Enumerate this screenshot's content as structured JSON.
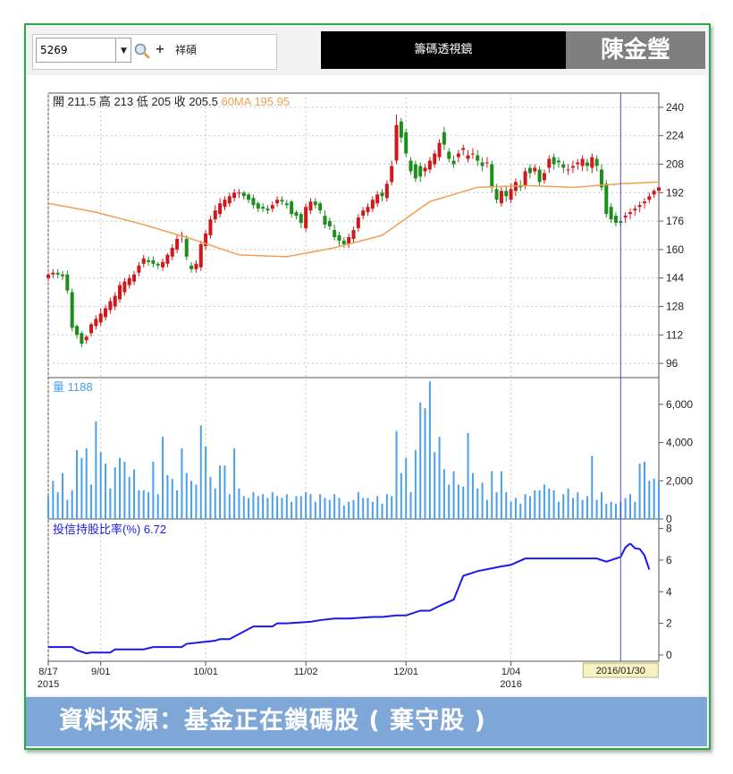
{
  "toolbar": {
    "stock_code": "5269",
    "dropdown_glyph": "▼",
    "zoom_icon": "magnifier-icon",
    "plus_label": "+",
    "detail_label": "祥碩",
    "title": "籌碼透視鏡",
    "author": "陳金瑩"
  },
  "footer": {
    "caption": "資料來源：基金正在鎖碼股 ( 棄守股 )"
  },
  "colors": {
    "up": "#d0181c",
    "down": "#1d8d1d",
    "ma": "#f0a050",
    "volume": "#4aa0e8",
    "holding": "#1a1ae6",
    "cursor": "#4a4ae0",
    "border": "#2aa84a",
    "footer": "#7ea6d6"
  },
  "chart_data": [
    {
      "type": "candlestick",
      "panel": "price",
      "legend": {
        "open_label": "開",
        "open": "211.5",
        "high_label": "高",
        "high": "213",
        "low_label": "低",
        "low": "205",
        "close_label": "收",
        "close": "205.5",
        "ma_label": "60MA",
        "ma": "195.95"
      },
      "ylim": [
        88,
        248
      ],
      "yticks": [
        96,
        112,
        128,
        144,
        160,
        176,
        192,
        208,
        224,
        240
      ],
      "series": [
        {
          "name": "60MA",
          "type": "line",
          "x": [
            0,
            10,
            20,
            30,
            40,
            50,
            60,
            70,
            80,
            90,
            100,
            110,
            120,
            128
          ],
          "values": [
            186,
            181,
            174,
            166,
            157,
            156,
            161,
            168,
            187,
            195,
            196,
            195,
            197,
            198
          ]
        },
        {
          "name": "K",
          "type": "candlestick",
          "x": [
            0,
            1,
            2,
            3,
            4,
            5,
            6,
            7,
            8,
            9,
            10,
            11,
            12,
            13,
            14,
            15,
            16,
            17,
            18,
            19,
            20,
            21,
            22,
            23,
            24,
            25,
            26,
            27,
            28,
            29,
            30,
            31,
            32,
            33,
            34,
            35,
            36,
            37,
            38,
            39,
            40,
            41,
            42,
            43,
            44,
            45,
            46,
            47,
            48,
            49,
            50,
            51,
            52,
            53,
            54,
            55,
            56,
            57,
            58,
            59,
            60,
            61,
            62,
            63,
            64,
            65,
            66,
            67,
            68,
            69,
            70,
            71,
            72,
            73,
            74,
            75,
            76,
            77,
            78,
            79,
            80,
            81,
            82,
            83,
            84,
            85,
            86,
            87,
            88,
            89,
            90,
            91,
            92,
            93,
            94,
            95,
            96,
            97,
            98,
            99,
            100,
            101,
            102,
            103,
            104,
            105,
            106,
            107,
            108,
            109,
            110,
            111,
            112,
            113,
            114,
            115,
            116,
            117,
            118,
            119,
            120,
            121,
            122,
            123,
            124,
            125,
            126,
            127,
            128
          ],
          "open": [
            144,
            146,
            147,
            146,
            146,
            136,
            117,
            113,
            109,
            113,
            117,
            119,
            122,
            126,
            128,
            132,
            136,
            140,
            142,
            147,
            152,
            154,
            154,
            152,
            150,
            152,
            156,
            160,
            168,
            166,
            151,
            149,
            150,
            162,
            168,
            177,
            180,
            184,
            186,
            189,
            192,
            192,
            191,
            189,
            186,
            184,
            183,
            183,
            186,
            188,
            186,
            187,
            181,
            180,
            172,
            182,
            187,
            186,
            179,
            176,
            171,
            168,
            165,
            163,
            166,
            172,
            179,
            181,
            183,
            186,
            192,
            189,
            198,
            210,
            232,
            226,
            210,
            208,
            207,
            204,
            205,
            208,
            212,
            226,
            215,
            210,
            212,
            216,
            211,
            214,
            213,
            209,
            209,
            208,
            194,
            186,
            193,
            188,
            193,
            196,
            196,
            206,
            204,
            205,
            199,
            206,
            212,
            210,
            208,
            205,
            206,
            208,
            207,
            209,
            206,
            211,
            205,
            197,
            184,
            179,
            176,
            178,
            180,
            182,
            184,
            186,
            188,
            191,
            193
          ],
          "close": [
            146,
            147,
            146,
            145,
            137,
            116,
            112,
            107,
            111,
            118,
            121,
            124,
            127,
            131,
            134,
            140,
            142,
            144,
            146,
            151,
            155,
            153,
            152,
            151,
            153,
            157,
            161,
            166,
            168,
            156,
            149,
            152,
            163,
            169,
            177,
            182,
            186,
            188,
            190,
            192,
            192,
            190,
            188,
            185,
            183,
            183,
            182,
            185,
            188,
            187,
            185,
            180,
            179,
            175,
            184,
            187,
            185,
            182,
            174,
            173,
            167,
            165,
            163,
            167,
            171,
            178,
            182,
            184,
            188,
            191,
            190,
            197,
            207,
            230,
            223,
            214,
            204,
            200,
            201,
            206,
            210,
            214,
            220,
            219,
            211,
            208,
            214,
            217,
            213,
            214,
            210,
            207,
            209,
            195,
            188,
            193,
            190,
            194,
            198,
            195,
            204,
            203,
            206,
            198,
            203,
            211,
            208,
            209,
            206,
            205,
            207,
            209,
            211,
            207,
            212,
            207,
            195,
            180,
            177,
            175,
            175,
            179,
            181,
            183,
            185,
            187,
            190,
            193,
            195
          ],
          "high": [
            147,
            149,
            149,
            148,
            148,
            138,
            118,
            114,
            112,
            119,
            123,
            127,
            129,
            133,
            136,
            142,
            144,
            146,
            148,
            153,
            157,
            156,
            156,
            153,
            155,
            158,
            163,
            168,
            170,
            168,
            153,
            154,
            165,
            171,
            179,
            185,
            189,
            190,
            192,
            194,
            194,
            193,
            192,
            191,
            187,
            186,
            185,
            187,
            190,
            190,
            188,
            188,
            182,
            181,
            186,
            189,
            189,
            187,
            182,
            178,
            174,
            170,
            167,
            169,
            173,
            180,
            184,
            186,
            190,
            193,
            194,
            199,
            210,
            236,
            234,
            228,
            212,
            210,
            209,
            208,
            212,
            216,
            222,
            229,
            217,
            213,
            216,
            219,
            216,
            217,
            216,
            212,
            212,
            210,
            197,
            195,
            196,
            197,
            200,
            199,
            206,
            208,
            208,
            207,
            205,
            213,
            214,
            212,
            210,
            208,
            210,
            211,
            213,
            211,
            214,
            213,
            208,
            199,
            186,
            181,
            178,
            181,
            183,
            185,
            187,
            189,
            192,
            194,
            196
          ],
          "low": [
            142,
            144,
            144,
            143,
            135,
            114,
            110,
            105,
            107,
            111,
            115,
            117,
            120,
            124,
            126,
            130,
            134,
            138,
            140,
            145,
            150,
            151,
            150,
            149,
            148,
            150,
            154,
            158,
            164,
            154,
            147,
            147,
            148,
            160,
            166,
            175,
            178,
            182,
            184,
            187,
            189,
            188,
            186,
            183,
            181,
            181,
            180,
            181,
            184,
            185,
            183,
            178,
            177,
            172,
            170,
            180,
            183,
            180,
            172,
            171,
            165,
            162,
            161,
            161,
            164,
            170,
            177,
            179,
            181,
            184,
            187,
            187,
            196,
            208,
            220,
            212,
            202,
            198,
            198,
            201,
            203,
            206,
            210,
            216,
            209,
            206,
            209,
            213,
            209,
            211,
            207,
            204,
            206,
            192,
            186,
            184,
            187,
            186,
            190,
            193,
            194,
            200,
            202,
            196,
            197,
            203,
            205,
            206,
            203,
            202,
            203,
            205,
            204,
            204,
            203,
            204,
            193,
            178,
            175,
            173,
            173,
            175,
            177,
            179,
            181,
            183,
            186,
            189,
            191
          ]
        }
      ]
    },
    {
      "type": "bar",
      "panel": "volume",
      "legend": {
        "label": "量",
        "value": "1188"
      },
      "ylim": [
        0,
        7400
      ],
      "yticks": [
        0,
        2000,
        4000,
        6000
      ],
      "ytick_labels": [
        "0",
        "2,000",
        "4,000",
        "6,000"
      ],
      "x": [
        0,
        1,
        2,
        3,
        4,
        5,
        6,
        7,
        8,
        9,
        10,
        11,
        12,
        13,
        14,
        15,
        16,
        17,
        18,
        19,
        20,
        21,
        22,
        23,
        24,
        25,
        26,
        27,
        28,
        29,
        30,
        31,
        32,
        33,
        34,
        35,
        36,
        37,
        38,
        39,
        40,
        41,
        42,
        43,
        44,
        45,
        46,
        47,
        48,
        49,
        50,
        51,
        52,
        53,
        54,
        55,
        56,
        57,
        58,
        59,
        60,
        61,
        62,
        63,
        64,
        65,
        66,
        67,
        68,
        69,
        70,
        71,
        72,
        73,
        74,
        75,
        76,
        77,
        78,
        79,
        80,
        81,
        82,
        83,
        84,
        85,
        86,
        87,
        88,
        89,
        90,
        91,
        92,
        93,
        94,
        95,
        96,
        97,
        98,
        99,
        100,
        101,
        102,
        103,
        104,
        105,
        106,
        107,
        108,
        109,
        110,
        111,
        112,
        113,
        114,
        115,
        116,
        117,
        118,
        119,
        120,
        121,
        122,
        123,
        124,
        125,
        126,
        127,
        128
      ],
      "values": [
        1200,
        2000,
        1400,
        2400,
        1000,
        1500,
        3600,
        3200,
        3700,
        1800,
        5100,
        3500,
        2900,
        1600,
        2700,
        3200,
        3000,
        2200,
        2600,
        1500,
        1500,
        1400,
        3000,
        1300,
        4300,
        2300,
        2100,
        1500,
        3700,
        2400,
        2000,
        1800,
        4900,
        3800,
        2200,
        1600,
        2800,
        2800,
        1300,
        3700,
        1600,
        1200,
        1100,
        1400,
        1200,
        1300,
        1100,
        1400,
        1200,
        1100,
        1300,
        900,
        1200,
        1200,
        1400,
        1300,
        900,
        1300,
        1100,
        1000,
        1300,
        1100,
        700,
        900,
        1000,
        1400,
        1100,
        1100,
        900,
        1200,
        800,
        1300,
        1200,
        4600,
        2400,
        3200,
        1400,
        3600,
        6100,
        5800,
        7200,
        3500,
        4300,
        2600,
        1800,
        2500,
        1800,
        1700,
        4500,
        2400,
        1600,
        1900,
        1000,
        2500,
        1400,
        2500,
        1400,
        900,
        1100,
        800,
        1300,
        1200,
        1500,
        1500,
        1800,
        1600,
        1500,
        900,
        1300,
        1600,
        1100,
        1400,
        1000,
        1200,
        3300,
        1000,
        1400,
        800,
        900,
        800,
        900,
        1100,
        1300,
        900,
        2900,
        3000,
        2000,
        2100,
        2000
      ]
    },
    {
      "type": "line",
      "panel": "holding",
      "legend": {
        "label": "投信持股比率(%)",
        "value": "6.72"
      },
      "ylim": [
        -0.4,
        8.6
      ],
      "yticks": [
        0,
        2,
        4,
        6,
        8
      ],
      "x": [
        0,
        5,
        6,
        8,
        9,
        13,
        14,
        20,
        22,
        28,
        29,
        35,
        36,
        38,
        43,
        47,
        48,
        50,
        55,
        57,
        60,
        63,
        68,
        70,
        73,
        75,
        78,
        80,
        82,
        85,
        87,
        90,
        95,
        97,
        100,
        101,
        105,
        107,
        115,
        117,
        120,
        121,
        122
      ],
      "values": [
        0.5,
        0.5,
        0.3,
        0.1,
        0.15,
        0.15,
        0.35,
        0.35,
        0.5,
        0.5,
        0.7,
        0.9,
        1.0,
        1.0,
        1.8,
        1.8,
        2.0,
        2.0,
        2.1,
        2.2,
        2.3,
        2.3,
        2.4,
        2.4,
        2.5,
        2.5,
        2.8,
        2.8,
        3.1,
        3.5,
        5.0,
        5.3,
        5.6,
        5.7,
        6.1,
        6.1,
        6.1,
        6.1,
        6.1,
        5.9,
        6.2,
        6.8,
        7.05
      ]
    },
    {
      "type": "axis",
      "panel": "time",
      "ticks": [
        {
          "x": 0,
          "label": "8/17",
          "sub": "2015"
        },
        {
          "x": 11,
          "label": "9/01",
          "sub": ""
        },
        {
          "x": 33,
          "label": "10/01",
          "sub": ""
        },
        {
          "x": 54,
          "label": "11/02",
          "sub": ""
        },
        {
          "x": 75,
          "label": "12/01",
          "sub": ""
        },
        {
          "x": 97,
          "label": "1/04",
          "sub": "2016"
        }
      ],
      "cursor": {
        "x": 120,
        "label": "2016/01/30"
      }
    }
  ]
}
